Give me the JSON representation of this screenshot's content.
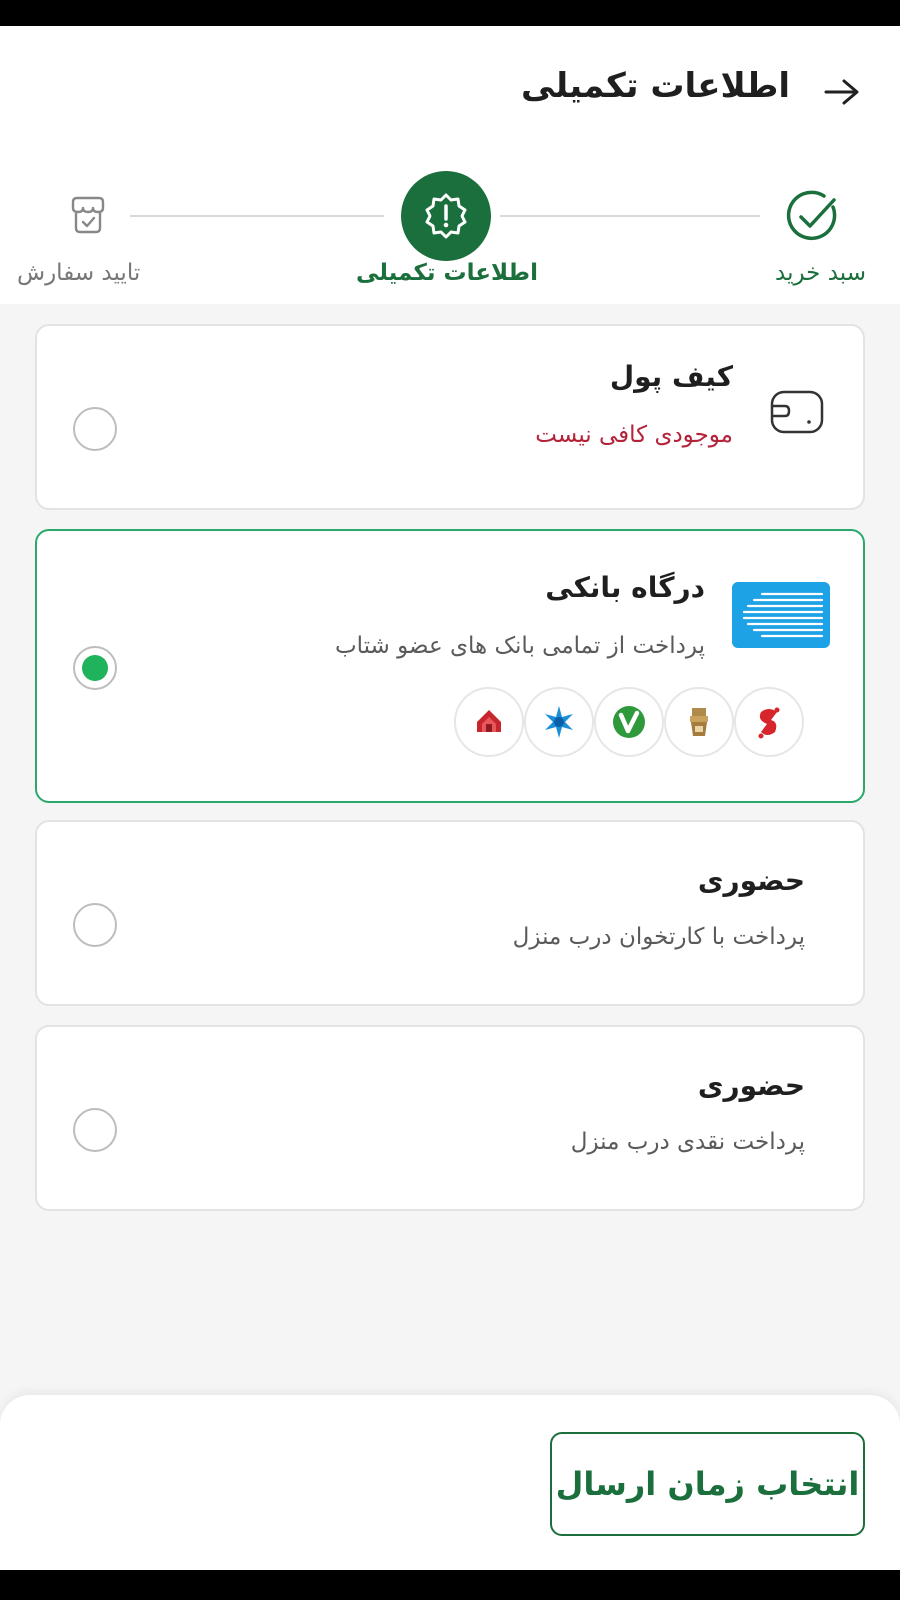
{
  "header": {
    "title": "اطلاعات تکمیلی",
    "back_icon": "arrow-right-icon"
  },
  "stepper": {
    "steps": [
      {
        "label": "سبد خرید",
        "icon": "check-circle-icon",
        "state": "done"
      },
      {
        "label": "اطلاعات تکمیلی",
        "icon": "info-badge-icon",
        "state": "current"
      },
      {
        "label": "تایید سفارش",
        "icon": "shop-icon",
        "state": "upcoming"
      }
    ]
  },
  "payment_options": [
    {
      "title": "کیف پول",
      "subtitle": "موجودی کافی نیست",
      "icon": "wallet-icon",
      "selected": false,
      "subtitle_color": "#b4233a"
    },
    {
      "title": "درگاه بانکی",
      "subtitle": "پرداخت از تمامی بانک های عضو شتاب",
      "icon": "shetab-logo",
      "selected": true,
      "banks": [
        {
          "name": "bank-tejarat-logo"
        },
        {
          "name": "bank-sepah-logo"
        },
        {
          "name": "bank-eghtesad-novin-logo"
        },
        {
          "name": "bank-saman-logo"
        },
        {
          "name": "bank-melli-logo"
        }
      ]
    },
    {
      "title": "حضوری",
      "subtitle": "پرداخت با کارتخوان درب منزل",
      "selected": false
    },
    {
      "title": "حضوری",
      "subtitle": "پرداخت نقدی درب منزل",
      "selected": false
    }
  ],
  "footer": {
    "button_label": "انتخاب زمان ارسال"
  },
  "colors": {
    "brand_green": "#1b6f3c",
    "radio_green": "#1fb35b",
    "selected_border": "#2ba96a",
    "warning_red": "#b4233a"
  }
}
